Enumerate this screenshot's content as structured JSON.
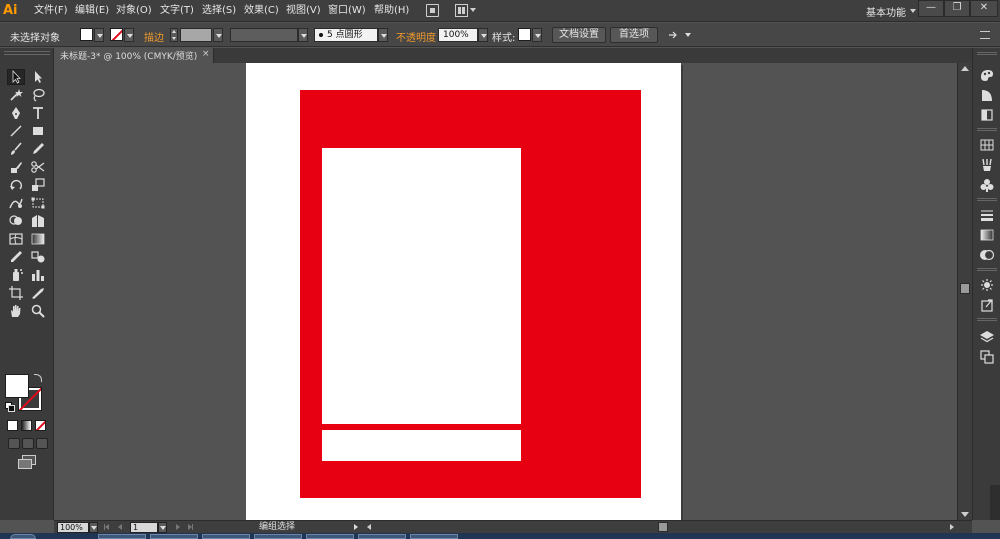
{
  "app": {
    "logo": "Ai",
    "workspace": "基本功能",
    "window_controls": [
      "—",
      "❐",
      "✕"
    ]
  },
  "menu": {
    "items": [
      "文件(F)",
      "编辑(E)",
      "对象(O)",
      "文字(T)",
      "选择(S)",
      "效果(C)",
      "视图(V)",
      "窗口(W)",
      "帮助(H)"
    ]
  },
  "control_bar": {
    "selection_status": "未选择对象",
    "stroke_label": "描边",
    "brush_label": "5 点圆形",
    "opacity_label": "不透明度",
    "opacity_value": "100%",
    "style_label": "样式",
    "doc_setup_button": "文档设置",
    "prefs_button": "首选项"
  },
  "document_tab": {
    "title": "未标题-3* @ 100% (CMYK/预览)",
    "close": "×"
  },
  "status_bar": {
    "zoom": "100%",
    "page": "1",
    "status_text": "编组选择"
  },
  "colors": {
    "accent_orange": "#f19a2a",
    "artwork_red": "#e60012",
    "artboard_white": "#ffffff",
    "canvas_gray": "#535353"
  },
  "icons": {
    "tools": [
      "selection-tool-icon",
      "direct-selection-tool-icon",
      "magic-wand-tool-icon",
      "lasso-tool-icon",
      "pen-tool-icon",
      "type-tool-icon",
      "line-tool-icon",
      "rectangle-tool-icon",
      "paintbrush-tool-icon",
      "pencil-tool-icon",
      "blob-brush-tool-icon",
      "scissors-tool-icon",
      "rotate-tool-icon",
      "scale-tool-icon",
      "warp-tool-icon",
      "free-transform-tool-icon",
      "shape-builder-tool-icon",
      "perspective-grid-tool-icon",
      "mesh-tool-icon",
      "gradient-tool-icon",
      "eyedropper-tool-icon",
      "blend-tool-icon",
      "symbol-sprayer-tool-icon",
      "column-graph-tool-icon",
      "artboard-tool-icon",
      "slice-tool-icon",
      "hand-tool-icon",
      "zoom-tool-icon"
    ],
    "dock": [
      "color-panel-icon",
      "color-guide-icon",
      "transparency-panel-icon",
      "swatches-panel-icon",
      "brushes-panel-icon",
      "symbols-panel-icon",
      "stroke-panel-icon",
      "gradient-panel-icon",
      "appearance-panel-icon",
      "graphic-styles-panel-icon",
      "layers-panel-icon",
      "artboards-panel-icon"
    ]
  }
}
